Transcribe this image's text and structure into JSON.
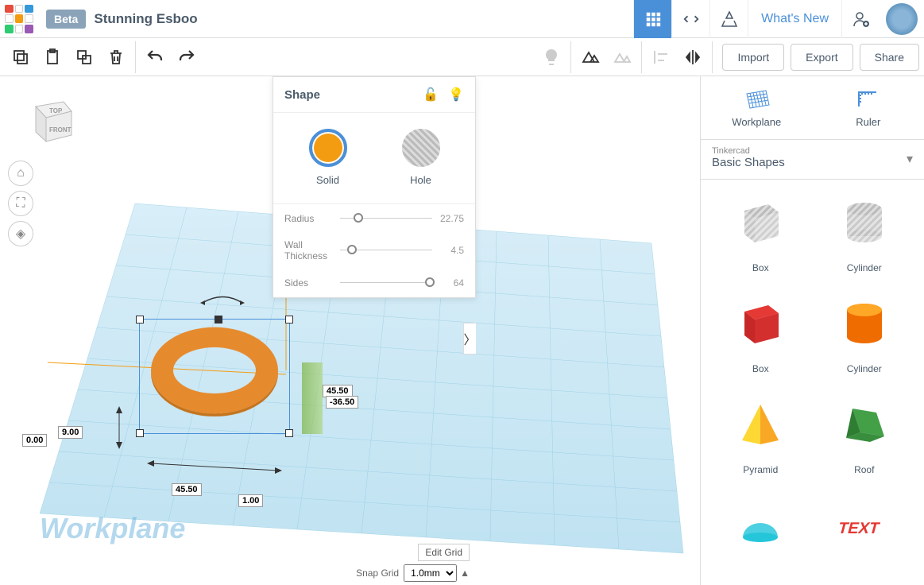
{
  "header": {
    "beta_label": "Beta",
    "project_title": "Stunning Esboo",
    "whats_new": "What's New"
  },
  "toolbar": {
    "import": "Import",
    "export": "Export",
    "share": "Share"
  },
  "viewcube": {
    "top": "TOP",
    "front": "FRONT"
  },
  "canvas": {
    "workplane_label": "Workplane",
    "edit_grid": "Edit Grid",
    "snap_grid_label": "Snap Grid",
    "snap_grid_value": "1.0mm",
    "dims": {
      "width": "45.50",
      "height": "45.50",
      "neg": "-36.50",
      "z": "9.00",
      "zero": "0.00",
      "one": "1.00"
    }
  },
  "shape_panel": {
    "title": "Shape",
    "solid": "Solid",
    "hole": "Hole",
    "props": [
      {
        "label": "Radius",
        "value": "22.75",
        "pos": 15
      },
      {
        "label": "Wall Thickness",
        "value": "4.5",
        "pos": 8
      },
      {
        "label": "Sides",
        "value": "64",
        "pos": 92
      }
    ]
  },
  "sidebar": {
    "workplane": "Workplane",
    "ruler": "Ruler",
    "category_small": "Tinkercad",
    "category": "Basic Shapes",
    "shapes": [
      {
        "name": "Box",
        "kind": "box-striped"
      },
      {
        "name": "Cylinder",
        "kind": "cyl-striped"
      },
      {
        "name": "Box",
        "kind": "box-red"
      },
      {
        "name": "Cylinder",
        "kind": "cyl-orange"
      },
      {
        "name": "Pyramid",
        "kind": "pyramid"
      },
      {
        "name": "Roof",
        "kind": "roof"
      }
    ]
  }
}
